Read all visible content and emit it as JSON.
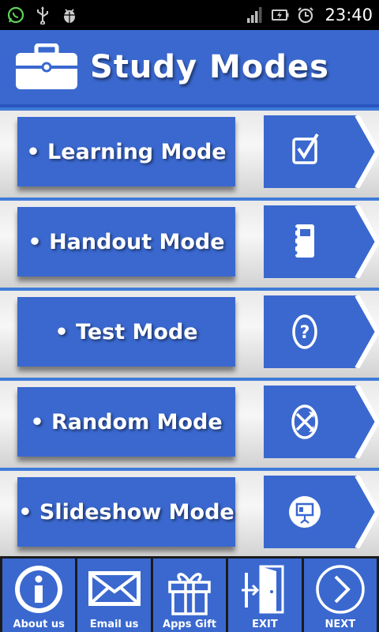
{
  "status_bar": {
    "time": "23:40",
    "icons": [
      "whatsapp-icon",
      "usb-icon",
      "android-debug-icon",
      "signal-icon",
      "battery-charging-icon",
      "alarm-icon"
    ]
  },
  "header": {
    "title": "Study Modes",
    "icon": "briefcase-icon"
  },
  "modes": [
    {
      "label": "• Learning Mode",
      "icon": "checkbox-icon"
    },
    {
      "label": "• Handout Mode",
      "icon": "notebook-icon"
    },
    {
      "label": "• Test Mode",
      "icon": "question-icon"
    },
    {
      "label": "• Random Mode",
      "icon": "shuffle-icon"
    },
    {
      "label": "• Slideshow Mode",
      "icon": "presentation-icon"
    }
  ],
  "bottom_bar": [
    {
      "label": "About us",
      "icon": "info-icon"
    },
    {
      "label": "Email us",
      "icon": "envelope-icon"
    },
    {
      "label": "Apps Gift",
      "icon": "gift-icon"
    },
    {
      "label": "EXIT",
      "icon": "exit-door-icon"
    },
    {
      "label": "NEXT",
      "icon": "next-arrow-icon"
    }
  ],
  "colors": {
    "primary_blue": "#3a68cf",
    "accent_blue": "#3f7bd8",
    "status_bar": "#000000",
    "bottom_bar_bg": "#1b1b1b"
  }
}
